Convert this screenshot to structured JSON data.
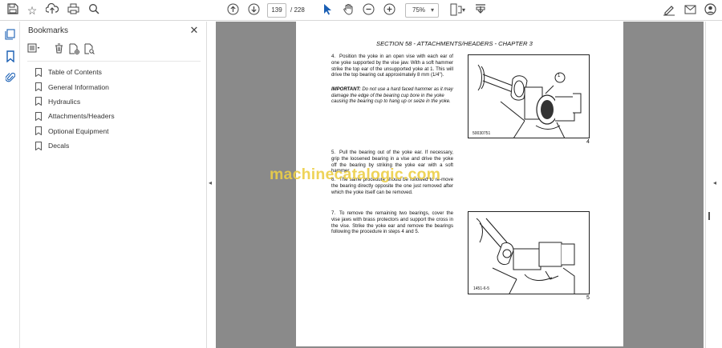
{
  "toolbar": {
    "page_current": "139",
    "page_total": "/ 228",
    "zoom": "75%"
  },
  "bookmarks_panel": {
    "title": "Bookmarks",
    "items": [
      {
        "label": "Table of Contents"
      },
      {
        "label": "General Information"
      },
      {
        "label": "Hydraulics"
      },
      {
        "label": "Attachments/Headers"
      },
      {
        "label": "Optional Equipment"
      },
      {
        "label": "Decals"
      }
    ]
  },
  "document": {
    "section_header": "SECTION 58 - ATTACHMENTS/HEADERS - CHAPTER 3",
    "step4": {
      "num": "4.",
      "text": "Position the yoke in an open vise with each ear of one yoke supported by the vise jaw. With a soft hammer strike the top ear of the unsupported yoke at 1. This will drive the top bearing out approximately 8 mm (1/4\")."
    },
    "important": {
      "label": "IMPORTANT:",
      "text": "Do not use a hard faced hammer as it may damage the edge of the bearing cup bore in the yoke causing the bearing cup to hang up or seize in the yoke."
    },
    "step5": {
      "num": "5.",
      "text": "Pull the bearing out of the yoke ear. If necessary, grip the loosened bearing in a vise and drive the yoke off the bearing by striking the yoke ear with a soft hammer."
    },
    "step6": {
      "num": "6.",
      "text": "The same procedure should be followed to re-move the bearing directly opposite the one just removed after which the yoke itself can be removed."
    },
    "step7": {
      "num": "7.",
      "text": "To remove the remaining two bearings, cover the vise jaws with brass protectors and support the cross in the vise. Strike the yoke ear and remove the bearings following the procedure in steps 4 and 5."
    },
    "figure4": {
      "code": "50030751",
      "callout": "1",
      "number": "4"
    },
    "figure5": {
      "code": "1451-6-5",
      "number": "5"
    }
  },
  "watermark": "machinecatalogic.com"
}
